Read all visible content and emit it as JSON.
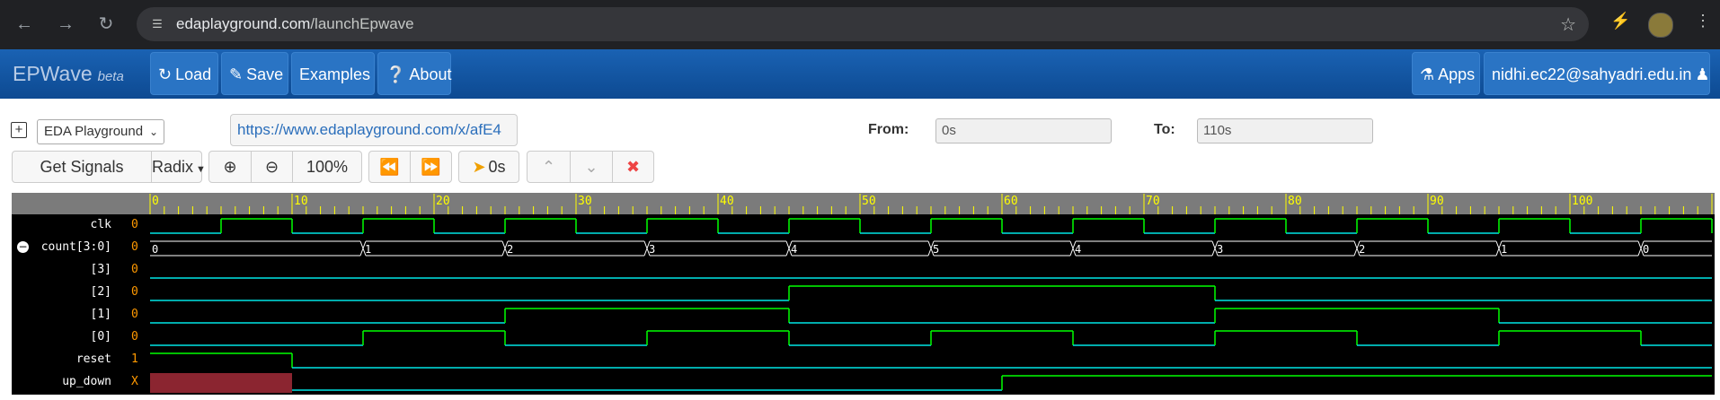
{
  "browser": {
    "url_host": "edaplayground.com",
    "url_path": "/launchEpwave"
  },
  "navbar": {
    "brand": "EPWave",
    "brand_tag": "beta",
    "load": "Load",
    "save": "Save",
    "examples": "Examples",
    "about": "About",
    "apps": "Apps",
    "user": "nidhi.ec22@sahyadri.edu.in"
  },
  "toolbar": {
    "playground_select": "EDA Playground",
    "share_link": "https://www.edaplayground.com/x/afE4",
    "from_label": "From:",
    "from_value": "0s",
    "to_label": "To:",
    "to_value": "110s",
    "get_signals": "Get Signals",
    "radix": "Radix",
    "zoom_level": "100%",
    "cursor_time": "0s"
  },
  "waveform": {
    "time_unit": "s",
    "range": [
      0,
      110
    ],
    "ruler_ticks": [
      0,
      10,
      20,
      30,
      40,
      50,
      60,
      70,
      80,
      90,
      100
    ],
    "signals": [
      {
        "name": "clk",
        "value": "0",
        "indent": 0
      },
      {
        "name": "count[3:0]",
        "value": "0",
        "indent": 0,
        "expanded": true
      },
      {
        "name": "[3]",
        "value": "0",
        "indent": 1
      },
      {
        "name": "[2]",
        "value": "0",
        "indent": 1
      },
      {
        "name": "[1]",
        "value": "0",
        "indent": 1
      },
      {
        "name": "[0]",
        "value": "0",
        "indent": 1
      },
      {
        "name": "reset",
        "value": "1",
        "indent": 0
      },
      {
        "name": "up_down",
        "value": "X",
        "indent": 0
      }
    ],
    "clk_edges": [
      0,
      5,
      10,
      15,
      20,
      25,
      30,
      35,
      40,
      45,
      50,
      55,
      60,
      65,
      70,
      75,
      80,
      85,
      90,
      95,
      100,
      105,
      110
    ],
    "count_bus": [
      {
        "t": 0,
        "v": "0"
      },
      {
        "t": 15,
        "v": "1"
      },
      {
        "t": 25,
        "v": "2"
      },
      {
        "t": 35,
        "v": "3"
      },
      {
        "t": 45,
        "v": "4"
      },
      {
        "t": 55,
        "v": "5"
      },
      {
        "t": 65,
        "v": "4"
      },
      {
        "t": 75,
        "v": "3"
      },
      {
        "t": 85,
        "v": "2"
      },
      {
        "t": 95,
        "v": "1"
      },
      {
        "t": 105,
        "v": "0"
      }
    ],
    "reset_high_until": 10,
    "up_down_x_until": 10,
    "up_down_high_from": 60,
    "colors": {
      "high": "#00ff00",
      "low": "#00e5e5",
      "unknown_fill": "#8b2530",
      "ruler_text": "#ffff00",
      "value_text": "#ff9900"
    }
  }
}
